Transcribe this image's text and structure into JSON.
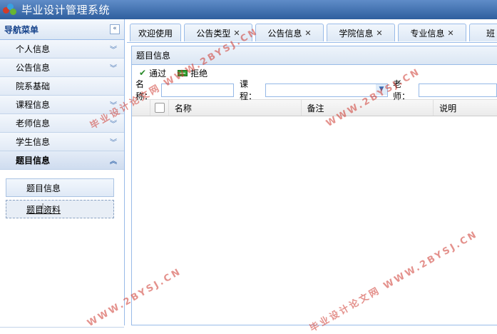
{
  "app": {
    "title": "毕业设计管理系统"
  },
  "sidebar": {
    "title": "导航菜单",
    "collapse_icon": "«",
    "items": [
      {
        "label": "个人信息",
        "icon": "double-chevron-down"
      },
      {
        "label": "公告信息",
        "icon": "double-chevron-down"
      },
      {
        "label": "院系基础",
        "icon": ""
      },
      {
        "label": "课程信息",
        "icon": "double-chevron-down"
      },
      {
        "label": "老师信息",
        "icon": "double-chevron-down"
      },
      {
        "label": "学生信息",
        "icon": "double-chevron-down"
      },
      {
        "label": "题目信息",
        "icon": "double-chevron-up"
      }
    ],
    "subitems": [
      "题目信息",
      "题目资料"
    ]
  },
  "tabs": [
    {
      "label": "欢迎使用",
      "closable": false
    },
    {
      "label": "公告类型",
      "closable": true
    },
    {
      "label": "公告信息",
      "closable": true
    },
    {
      "label": "学院信息",
      "closable": true
    },
    {
      "label": "专业信息",
      "closable": true
    },
    {
      "label": "班",
      "closable": false
    }
  ],
  "panel": {
    "title": "题目信息",
    "toolbar": {
      "approve": "通过",
      "reject": "拒绝"
    },
    "search": {
      "name_label": "名称：",
      "course_label": "课程：",
      "teacher_label": "老师：",
      "name_value": "",
      "course_value": "",
      "teacher_value": ""
    },
    "grid": {
      "columns": [
        "名称",
        "备注",
        "说明"
      ]
    }
  },
  "watermark": {
    "text_cn": "毕业设计论文网",
    "text_url": "WWW.2BYSJ.CN",
    "color": "#cd372d"
  }
}
